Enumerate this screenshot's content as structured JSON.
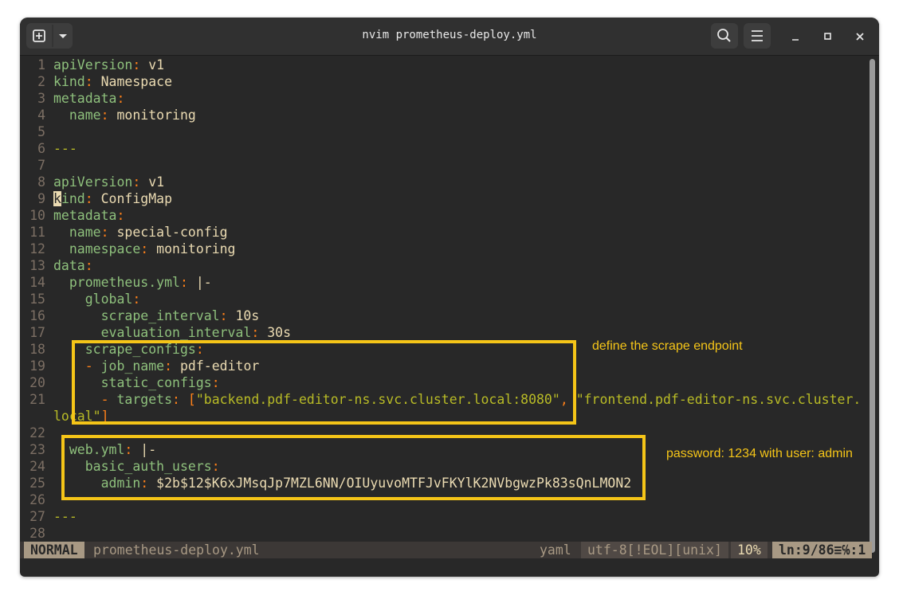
{
  "window": {
    "title": "nvim prometheus-deploy.yml",
    "new_tab_icon": "plus-box-icon",
    "dropdown_icon": "chevron-down-icon",
    "search_icon": "search-icon",
    "menu_icon": "hamburger-menu-icon",
    "minimize_glyph": "–",
    "maximize_glyph": "▪",
    "close_glyph": "✕"
  },
  "editor": {
    "lines": [
      {
        "n": "1"
      },
      {
        "n": "2"
      },
      {
        "n": "3"
      },
      {
        "n": "4"
      },
      {
        "n": "5"
      },
      {
        "n": "6"
      },
      {
        "n": "7"
      },
      {
        "n": "8"
      },
      {
        "n": "9"
      },
      {
        "n": "10"
      },
      {
        "n": "11"
      },
      {
        "n": "12"
      },
      {
        "n": "13"
      },
      {
        "n": "14"
      },
      {
        "n": "15"
      },
      {
        "n": "16"
      },
      {
        "n": "17"
      },
      {
        "n": "18"
      },
      {
        "n": "19"
      },
      {
        "n": "20"
      },
      {
        "n": "21"
      },
      {
        "n": "22"
      },
      {
        "n": "23"
      },
      {
        "n": "24"
      },
      {
        "n": "25"
      },
      {
        "n": "26"
      },
      {
        "n": "27"
      },
      {
        "n": "28"
      }
    ],
    "text": {
      "l1a": "apiVersion",
      "l1b": "v1",
      "l2a": "kind",
      "l2b": "Namespace",
      "l3a": "metadata",
      "l4a": "name",
      "l4b": "monitoring",
      "l6": "---",
      "l8a": "apiVersion",
      "l8b": "v1",
      "l9cur": "k",
      "l9a": "ind",
      "l9b": "ConfigMap",
      "l10a": "metadata",
      "l11a": "name",
      "l11b": "special-config",
      "l12a": "namespace",
      "l12b": "monitoring",
      "l13a": "data",
      "l14a": "prometheus.yml",
      "l14b": "|-",
      "l15a": "global",
      "l16a": "scrape_interval",
      "l16b": "10s",
      "l17a": "evaluation_interval",
      "l17b": "30s",
      "l18a": "scrape_configs",
      "l19dash": "-",
      "l19a": "job_name",
      "l19b": "pdf-editor",
      "l20a": "static_configs",
      "l21dash": "-",
      "l21a": "targets",
      "l21b": "\"backend.pdf-editor-ns.svc.cluster.local:8080\"",
      "l21c": "\"frontend.pdf-editor-ns.svc.cluster.",
      "l21wrap": "local\"",
      "l23a": "web.yml",
      "l23b": "|-",
      "l24a": "basic_auth_users",
      "l25a": "admin",
      "l25b": "$2b$12$K6xJMsqJp7MZL6NN/OIUyuvoMTFJvFKYlK2NVbgwzPk83sQnLMON2",
      "l27": "---"
    }
  },
  "annotations": {
    "scrape_note": "define the scrape endpoint",
    "auth_note": "password: 1234 with user: admin",
    "color": "#f5c518"
  },
  "statusline": {
    "mode": "NORMAL",
    "filename": "prometheus-deploy.yml",
    "filetype": "yaml",
    "encoding": "utf-8[!EOL][unix]",
    "percent": "10%",
    "position": "ln:9/86≡℅:1"
  }
}
